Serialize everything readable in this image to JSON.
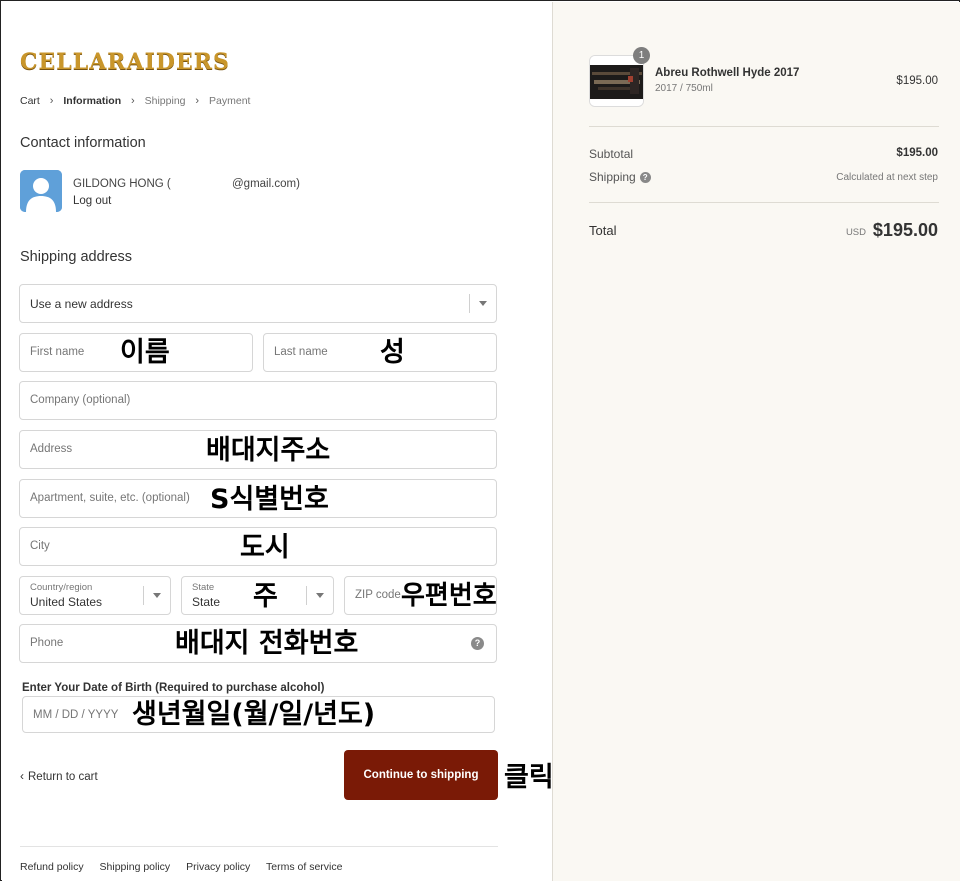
{
  "brand": {
    "logo_text": "CELLARAIDERS"
  },
  "breadcrumb": {
    "items": [
      {
        "label": "Cart"
      },
      {
        "label": "Information"
      },
      {
        "label": "Shipping"
      },
      {
        "label": "Payment"
      }
    ]
  },
  "contact": {
    "title": "Contact information",
    "name": "GILDONG HONG (",
    "email": "@gmail.com)",
    "logout": "Log out"
  },
  "shipping": {
    "title": "Shipping address",
    "address_select": "Use a new address",
    "first_name_placeholder": "First name",
    "last_name_placeholder": "Last name",
    "company_placeholder": "Company (optional)",
    "address_placeholder": "Address",
    "apartment_placeholder": "Apartment, suite, etc. (optional)",
    "city_placeholder": "City",
    "country_label": "Country/region",
    "country_value": "United States",
    "state_label": "State",
    "state_value": "State",
    "zip_placeholder": "ZIP code",
    "phone_placeholder": "Phone",
    "dob_label": "Enter Your Date of Birth (Required to purchase alcohol)",
    "dob_placeholder": "MM / DD / YYYY"
  },
  "annotations": {
    "first_name": "이름",
    "last_name": "성",
    "address": "배대지주소",
    "apartment": "S식별번호",
    "city": "도시",
    "state": "주",
    "zip": "우편번호",
    "phone": "배대지 전화번호",
    "dob": "생년월일(월/일/년도)",
    "click": "클릭"
  },
  "actions": {
    "return_label": "Return to cart",
    "continue_label": "Continue to shipping"
  },
  "footer": {
    "links": [
      "Refund policy",
      "Shipping policy",
      "Privacy policy",
      "Terms of service"
    ]
  },
  "order": {
    "quantity": "1",
    "product_name": "Abreu Rothwell Hyde 2017",
    "product_variant": "2017 / 750ml",
    "product_price": "$195.00",
    "subtotal_label": "Subtotal",
    "subtotal_value": "$195.00",
    "shipping_label": "Shipping",
    "shipping_value": "Calculated at next step",
    "total_label": "Total",
    "currency": "USD",
    "total_value": "$195.00"
  },
  "colors": {
    "primary_button": "#7a1a06",
    "sidebar_bg": "#faf8f3",
    "logo_gold": "#c9962b"
  }
}
